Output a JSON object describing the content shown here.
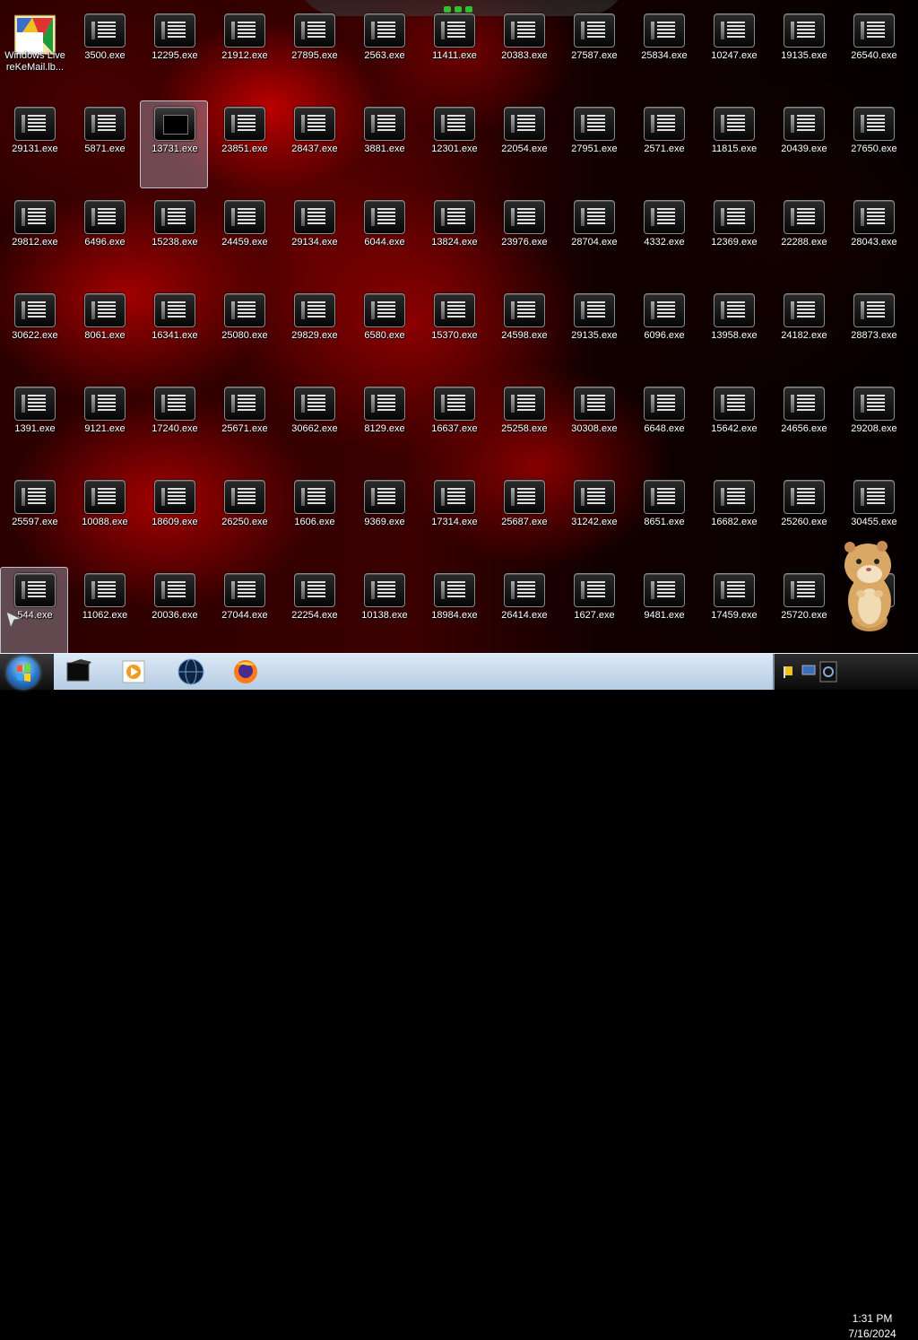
{
  "desktop": {
    "wlm_icon": {
      "label": "Windows Live reKeMail.lb...",
      "icon": "windows-live-mail-icon"
    },
    "rows": [
      [
        "3500.exe",
        "12295.exe",
        "21912.exe",
        "27895.exe",
        "2563.exe",
        "11411.exe",
        "20383.exe",
        "27587.exe",
        "25834.exe",
        "10247.exe",
        "19135.exe",
        "26540.exe"
      ],
      [
        "29131.exe",
        "5871.exe",
        "13731.exe",
        "23851.exe",
        "28437.exe",
        "3881.exe",
        "12301.exe",
        "22054.exe",
        "27951.exe",
        "2571.exe",
        "11815.exe",
        "20439.exe",
        "27650.exe"
      ],
      [
        "29812.exe",
        "6496.exe",
        "15238.exe",
        "24459.exe",
        "29134.exe",
        "6044.exe",
        "13824.exe",
        "23976.exe",
        "28704.exe",
        "4332.exe",
        "12369.exe",
        "22288.exe",
        "28043.exe"
      ],
      [
        "30622.exe",
        "8061.exe",
        "16341.exe",
        "25080.exe",
        "29829.exe",
        "6580.exe",
        "15370.exe",
        "24598.exe",
        "29135.exe",
        "6096.exe",
        "13958.exe",
        "24182.exe",
        "28873.exe"
      ],
      [
        "1391.exe",
        "9121.exe",
        "17240.exe",
        "25671.exe",
        "30662.exe",
        "8129.exe",
        "16637.exe",
        "25258.exe",
        "30308.exe",
        "6648.exe",
        "15642.exe",
        "24656.exe",
        "29208.exe"
      ],
      [
        "25597.exe",
        "10088.exe",
        "18609.exe",
        "26250.exe",
        "1606.exe",
        "9369.exe",
        "17314.exe",
        "25687.exe",
        "31242.exe",
        "8651.exe",
        "16682.exe",
        "25260.exe",
        "30455.exe"
      ],
      [
        "544.exe",
        "11062.exe",
        "20036.exe",
        "27044.exe",
        "22254.exe",
        "10138.exe",
        "18984.exe",
        "26414.exe",
        "1627.exe",
        "9481.exe",
        "17459.exe",
        "25720.exe",
        "exe"
      ]
    ],
    "hamster_icon": "hamster-gadget"
  },
  "taskbar": {
    "start_icon": "windows-start-orb",
    "pinned": [
      "terminal-app-icon",
      "media-player-icon",
      "browser-globe-icon",
      "firefox-icon"
    ],
    "tray_icons": [
      "flag-icon",
      "network-icon",
      "volume-icon"
    ],
    "clock": {
      "time": "1:31 PM",
      "date": "7/16/2024"
    }
  },
  "colors": {
    "taskbar_bg": "#c9dbee",
    "selection": "#c8d2e6",
    "label_text": "#ffffff"
  }
}
